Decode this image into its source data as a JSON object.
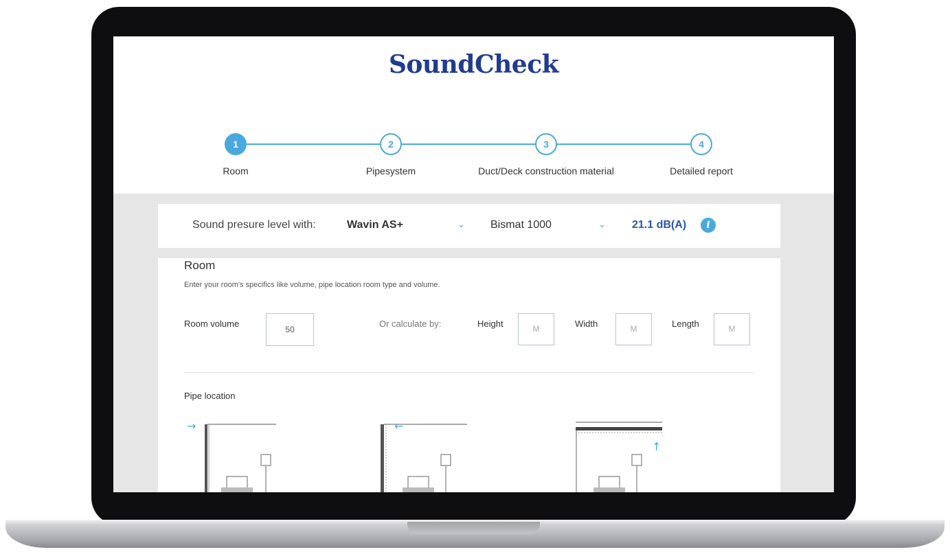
{
  "app": {
    "logo": "SoundCheck"
  },
  "steps": [
    {
      "number": "1",
      "label": "Room",
      "active": true
    },
    {
      "number": "2",
      "label": "Pipesystem",
      "active": false
    },
    {
      "number": "3",
      "label": "Duct/Deck construction material",
      "active": false
    },
    {
      "number": "4",
      "label": "Detailed report",
      "active": false
    }
  ],
  "sound_pressure": {
    "label": "Sound presure level with:",
    "pipe_select": "Wavin AS+",
    "material_select": "Bismat 1000",
    "value": "21.1 dB(A)"
  },
  "room": {
    "title": "Room",
    "description": "Enter your room's specifics like volume, pipe location room type and volume.",
    "volume_label": "Room volume",
    "volume_value": "50",
    "calc_label": "Or calculate by:",
    "height_label": "Height",
    "height_placeholder": "M",
    "width_label": "Width",
    "width_placeholder": "M",
    "length_label": "Length",
    "length_placeholder": "M"
  },
  "pipe_location": {
    "label": "Pipe location",
    "options": [
      {
        "id": "wall-outside",
        "arrow": "→"
      },
      {
        "id": "wall-inside",
        "arrow": "←"
      },
      {
        "id": "ceiling",
        "arrow": "↑"
      }
    ]
  },
  "colors": {
    "brand": "#213c8f",
    "accent": "#49a9df",
    "value": "#2a56a5",
    "background": "#e6e6e6"
  }
}
